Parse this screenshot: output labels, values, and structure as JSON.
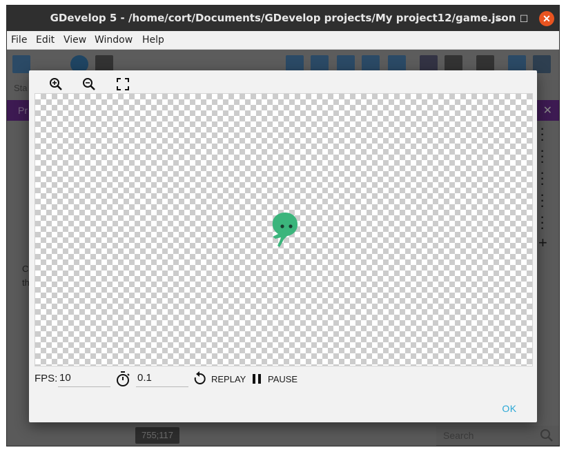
{
  "window": {
    "title": "GDevelop 5 - /home/cort/Documents/GDevelop projects/My project12/game.json",
    "minimize_glyph": "—",
    "maximize_glyph": "☐",
    "close_glyph": "✕"
  },
  "menubar": {
    "items": [
      "File",
      "Edit",
      "View",
      "Window",
      "Help"
    ]
  },
  "background": {
    "status_text": "Sta",
    "purple_tab_text": "Pr",
    "left_text_1": "C",
    "left_text_2": "th",
    "coordinates": "755;117",
    "search_placeholder": "Search"
  },
  "modal": {
    "fps_label": "FPS:",
    "fps_value": "10",
    "time_value": "0.1",
    "replay_label": "REPLAY",
    "pause_label": "PAUSE",
    "ok_label": "OK",
    "icons": {
      "zoom_in": "zoom-in-icon",
      "zoom_out": "zoom-out-icon",
      "fit": "fullscreen-icon",
      "timer": "timer-icon",
      "replay": "replay-icon",
      "pause": "pause-icon"
    },
    "sprite_color": "#3bb57c"
  },
  "colors": {
    "accent": "#2aa8d6",
    "close_button": "#e95420",
    "purple_bar": "#3d1a52"
  }
}
